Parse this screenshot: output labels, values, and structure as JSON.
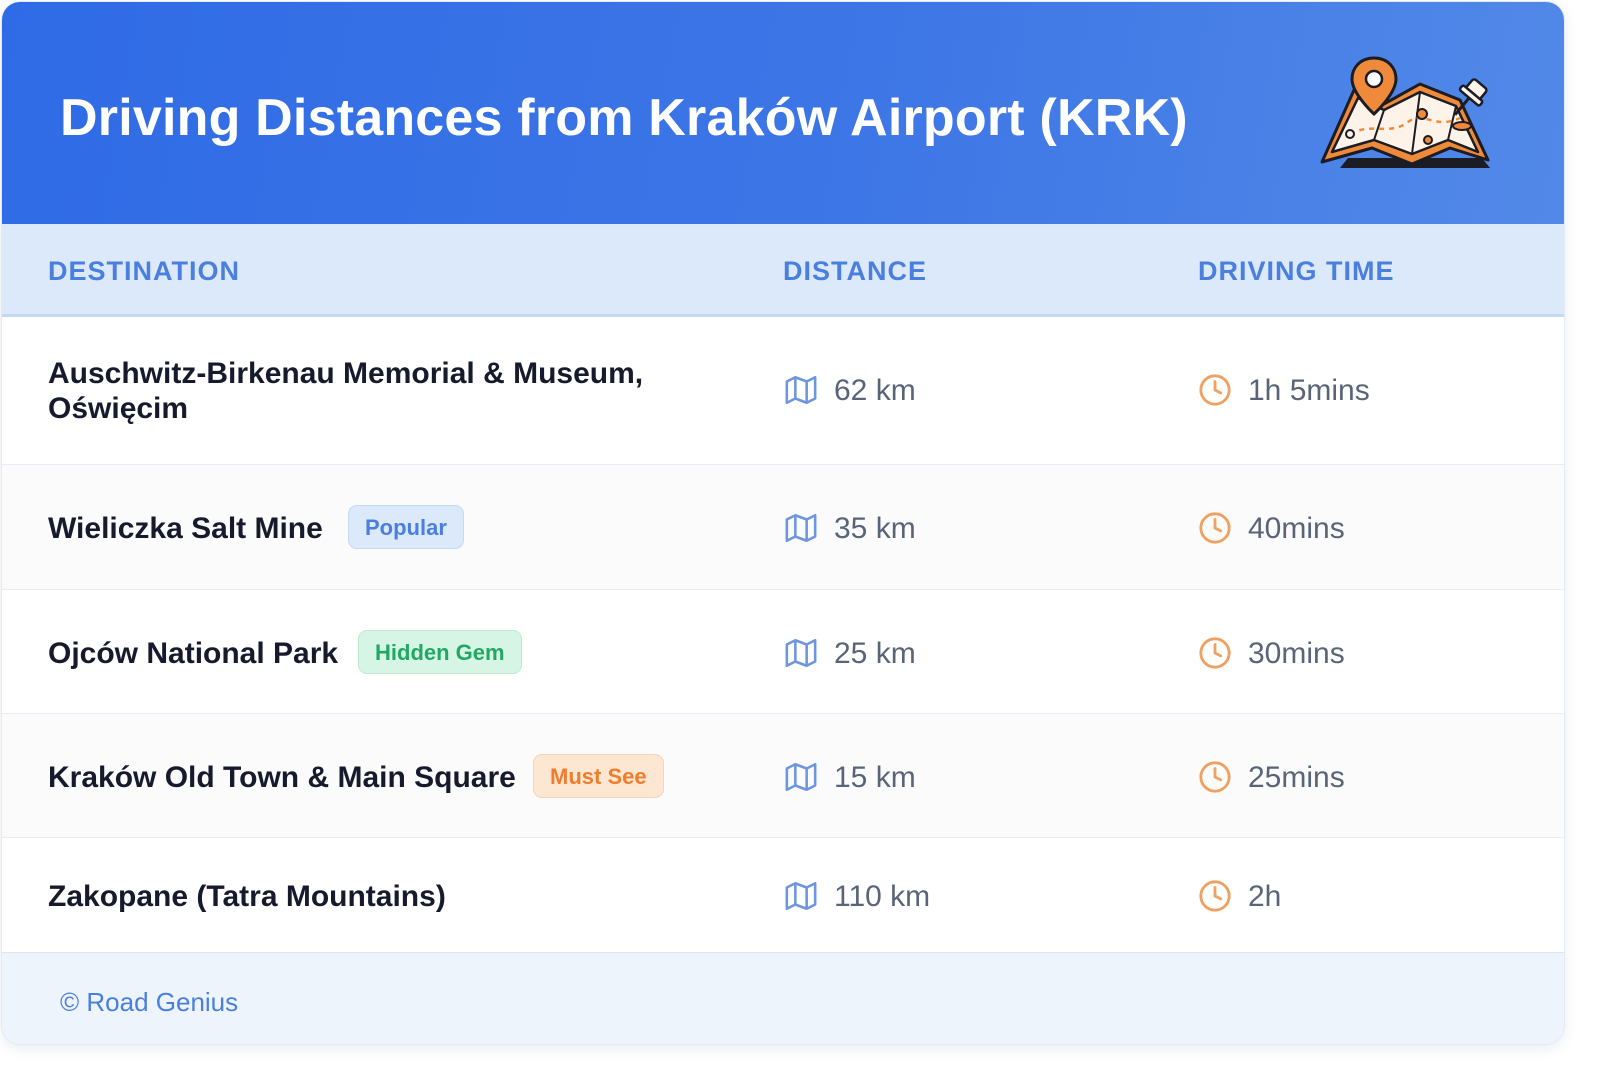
{
  "header": {
    "title": "Driving Distances from Kraków Airport (KRK)",
    "illustration": "folded-map-with-location-pin-icon"
  },
  "table": {
    "columns": [
      "DESTINATION",
      "DISTANCE",
      "DRIVING TIME"
    ],
    "rows": [
      {
        "destination_line1": "Auschwitz-Birkenau Memorial & Museum,",
        "destination_line2": "Oświęcim",
        "badge": "",
        "distance": "62 km",
        "time": "1h 5mins"
      },
      {
        "destination": "Wieliczka Salt Mine",
        "badge": "Popular",
        "distance": "35 km",
        "time": "40mins"
      },
      {
        "destination": "Ojców National Park",
        "badge": "Hidden Gem",
        "distance": "25 km",
        "time": "30mins"
      },
      {
        "destination": "Kraków Old Town & Main Square",
        "badge": "Must See",
        "distance": "15 km",
        "time": "25mins"
      },
      {
        "destination": "Zakopane (Tatra Mountains)",
        "badge": "",
        "distance": "110 km",
        "time": "2h"
      }
    ]
  },
  "footer": {
    "credit": "© Road Genius"
  },
  "icons": {
    "distance": "map-icon",
    "time": "clock-icon"
  },
  "colors": {
    "header_start": "#2f6be6",
    "header_end": "#5289e8",
    "accent_blue": "#4a7fe0",
    "badge_green": "#21a865",
    "badge_orange": "#ef7d2b",
    "clock_orange": "#f0a060"
  }
}
